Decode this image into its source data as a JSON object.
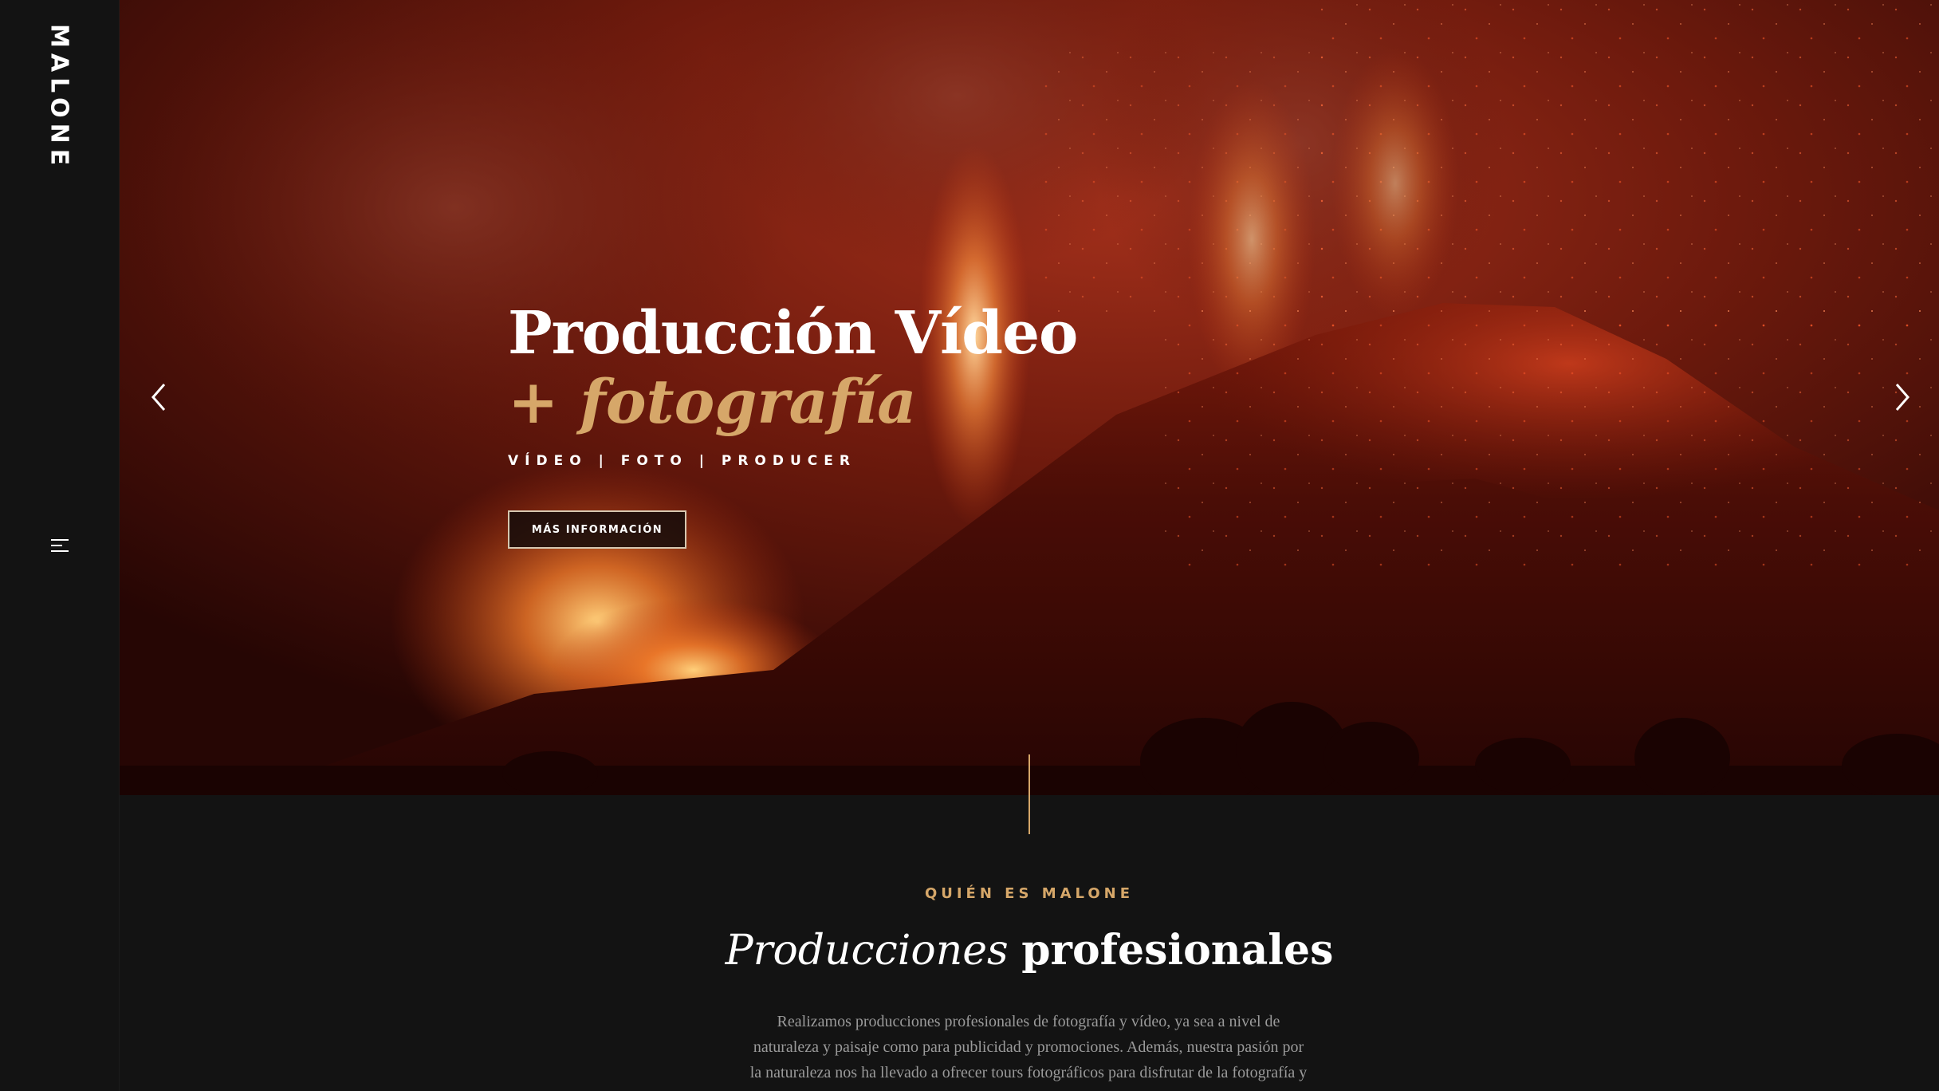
{
  "sidebar": {
    "brand": "MALONE",
    "menu_icon": "hamburger-menu-icon"
  },
  "hero": {
    "title": "Producción Vídeo",
    "subtitle": "+ fotografía",
    "tags": "VÍDEO | FOTO | PRODUCER",
    "button_label": "MÁS INFORMACIÓN",
    "prev_icon": "chevron-left-icon",
    "next_icon": "chevron-right-icon",
    "background_image": "volcano eruption at night"
  },
  "about": {
    "kicker": "QUIÉN ES MALONE",
    "heading_italic": "Producciones",
    "heading_bold": "profesionales",
    "text": "Realizamos producciones profesionales de fotografía y vídeo, ya sea a nivel de naturaleza y paisaje como para publicidad y promociones. Además, nuestra pasión por la naturaleza nos ha llevado a ofrecer tours fotográficos para disfrutar de la fotografía y"
  },
  "colors": {
    "accent_gold": "#d6a769",
    "background_dark": "#131313",
    "text_muted": "#9a9a9a"
  }
}
